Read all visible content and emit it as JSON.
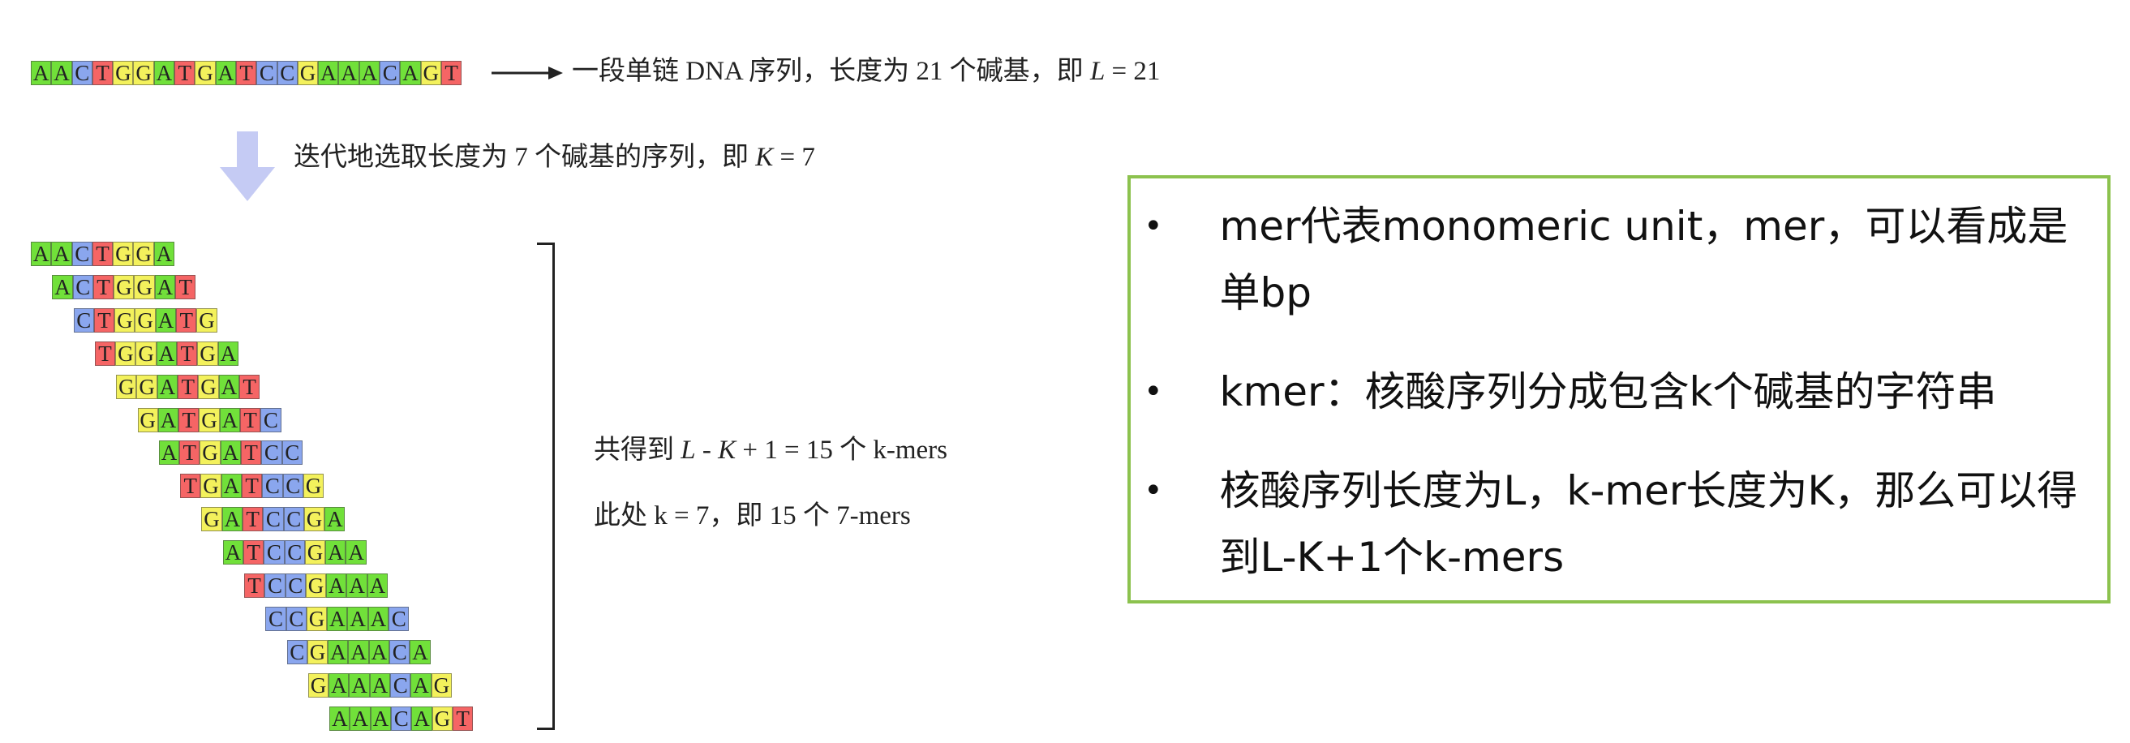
{
  "dna": {
    "full_sequence": "AACTGGATGATCCGAAACAGT",
    "full_caption_text": "一段单链 DNA 序列，长度为 21 个碱基，即 ",
    "full_caption_var": "L",
    "full_caption_eq": " = 21",
    "arrow_caption_text": "迭代地选取长度为 7 个碱基的序列，即 ",
    "arrow_caption_var": "K",
    "arrow_caption_eq": " = 7",
    "kmers": [
      "AACTGGA",
      "ACTGGAT",
      "CTGGATG",
      "TGGATGA",
      "GGATGAT",
      "GATGATC",
      "ATGATCC",
      "TGATCCG",
      "GATCCGA",
      "ATCCGAA",
      "TCCGAAA",
      "CCGAAAC",
      "CGAAACA",
      "GAAACAG",
      "AAACAGT"
    ],
    "result_prefix": "共得到 ",
    "result_L": "L",
    "result_minus": " - ",
    "result_K": "K",
    "result_suffix": " + 1 = 15 个 k-mers",
    "result_line2": "此处 k = 7，即 15 个 7-mers"
  },
  "colors": {
    "A": "#71e03a",
    "C": "#8aa6ee",
    "T": "#f56565",
    "G": "#f3f15c",
    "box_border": "#8cc24e",
    "arrow_fill": "#c5cbf4"
  },
  "notes": {
    "bullets": [
      "mer代表monomeric unit，mer，可以看成是单bp",
      "kmer：核酸序列分成包含k个碱基的字符串",
      "核酸序列长度为L，k-mer长度为K，那么可以得到L-K+1个k-mers"
    ]
  }
}
